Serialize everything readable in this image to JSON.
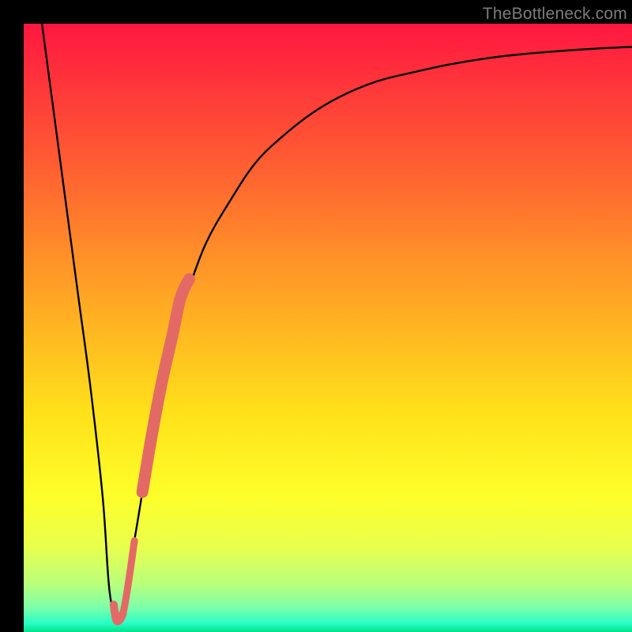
{
  "attribution": "TheBottleneck.com",
  "chart_data": {
    "type": "line",
    "title": "",
    "xlabel": "",
    "ylabel": "",
    "xlim": [
      0,
      100
    ],
    "ylim": [
      0,
      100
    ],
    "series": [
      {
        "name": "bottleneck-curve",
        "stroke": "#000000",
        "x": [
          3,
          5,
          7,
          9,
          11,
          13,
          14.2,
          15.8,
          18,
          20,
          22,
          24,
          27,
          30,
          34,
          38,
          42,
          47,
          52,
          58,
          64,
          70,
          76,
          82,
          88,
          94,
          100
        ],
        "y": [
          100,
          85,
          70,
          55,
          40,
          22,
          6,
          3,
          14,
          26,
          38,
          47,
          56,
          64,
          71,
          77,
          81,
          85,
          88,
          90.5,
          92,
          93.3,
          94.3,
          95,
          95.5,
          95.9,
          96.2
        ]
      },
      {
        "name": "highlight-segment",
        "stroke": "#e36a64",
        "x": [
          15.5,
          16.3,
          17.2,
          18.2,
          19.5,
          21.0,
          22.7,
          24.5,
          25.8,
          27.2
        ],
        "y": [
          2.0,
          3.0,
          8.0,
          15.0,
          23.0,
          32.0,
          41.0,
          49.0,
          55.0,
          58.0
        ]
      }
    ],
    "highlight_thick_range": {
      "x0": 19.0,
      "x1": 27.2
    },
    "highlight_hook": {
      "note": "small J-hook at curve minimum",
      "x": [
        14.8,
        15.2,
        15.8,
        16.3
      ],
      "y": [
        4.5,
        2.0,
        2.0,
        3.0
      ]
    }
  }
}
